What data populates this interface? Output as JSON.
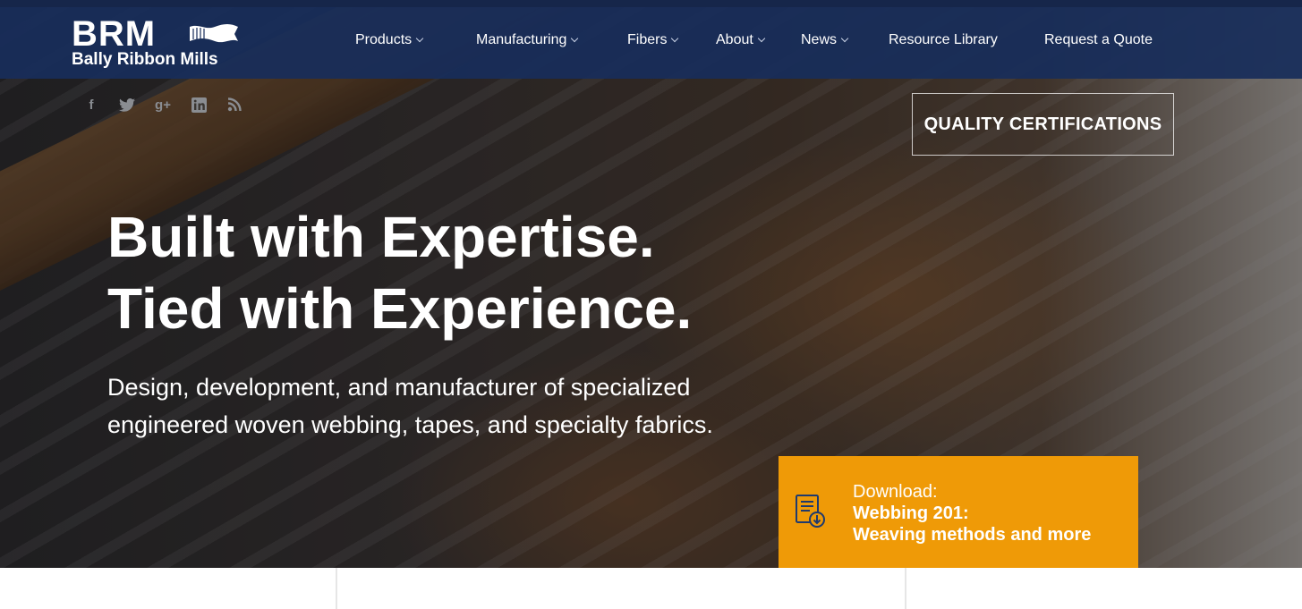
{
  "brand": {
    "mark": "BRM",
    "name": "Bally Ribbon Mills"
  },
  "nav": {
    "items": [
      {
        "label": "Products",
        "dropdown": true
      },
      {
        "label": "Manufacturing",
        "dropdown": true
      },
      {
        "label": "Fibers",
        "dropdown": true
      },
      {
        "label": "About",
        "dropdown": true
      },
      {
        "label": "News",
        "dropdown": true
      },
      {
        "label": "Resource Library",
        "dropdown": false
      },
      {
        "label": "Request a Quote",
        "dropdown": false
      }
    ]
  },
  "social": {
    "icons": [
      "facebook-icon",
      "twitter-icon",
      "google-plus-icon",
      "linkedin-icon",
      "rss-icon"
    ],
    "glyphs": [
      "f",
      "𝕥",
      "g+",
      "in",
      "◔"
    ]
  },
  "hero": {
    "quality_button": "QUALITY CERTIFICATIONS",
    "line1_light": "Built with ",
    "line1_bold": "Expertise.",
    "line2_light": "Tied with ",
    "line2_bold": "Experience.",
    "subhead": "Design, development, and manufacturer of specialized engineered woven webbing, tapes, and specialty fabrics."
  },
  "download": {
    "line1": "Download:",
    "line2": "Webbing 201:",
    "line3": "Weaving methods and more"
  },
  "colors": {
    "navbar": "#182d5a",
    "accent": "#ef9a07"
  }
}
